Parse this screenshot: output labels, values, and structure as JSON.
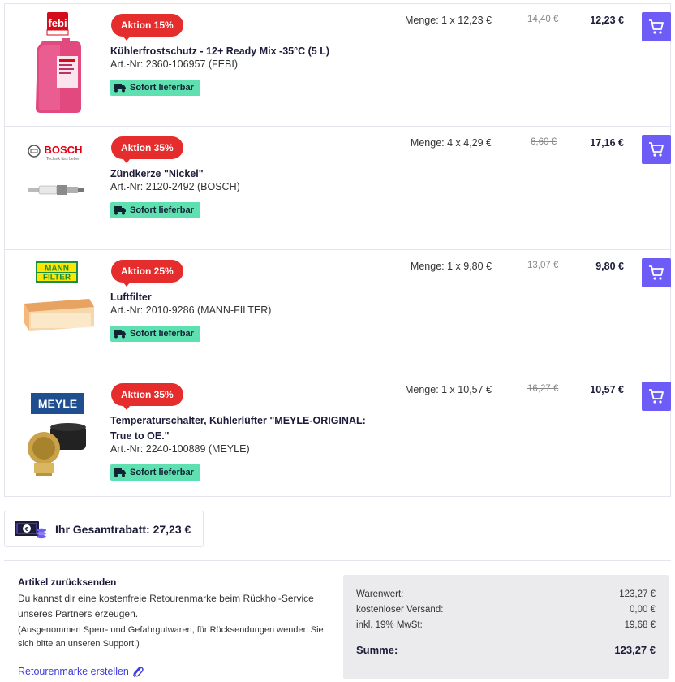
{
  "items": [
    {
      "badge": "Aktion 15%",
      "title": "Kühlerfrostschutz - 12+ Ready Mix -35°C (5 L)",
      "artnr": "Art.-Nr: 2360-106957 (FEBI)",
      "stock": "Sofort lieferbar",
      "qty": "Menge: 1 x 12,23 €",
      "old_price": "14,40 €",
      "price": "12,23 €",
      "brand": "febi bilstein"
    },
    {
      "badge": "Aktion 35%",
      "title": "Zündkerze \"Nickel\"",
      "artnr": "Art.-Nr: 2120-2492 (BOSCH)",
      "stock": "Sofort lieferbar",
      "qty": "Menge: 4 x 4,29 €",
      "old_price": "6,60 €",
      "price": "17,16 €",
      "brand": "BOSCH",
      "brand_tagline": "Technik fürs Leben"
    },
    {
      "badge": "Aktion 25%",
      "title": "Luftfilter",
      "artnr": "Art.-Nr: 2010-9286 (MANN-FILTER)",
      "stock": "Sofort lieferbar",
      "qty": "Menge: 1 x 9,80 €",
      "old_price": "13,07 €",
      "price": "9,80 €",
      "brand_line1": "MANN",
      "brand_line2": "FILTER"
    },
    {
      "badge": "Aktion 35%",
      "title": "Temperaturschalter, Kühlerlüfter \"MEYLE-ORIGINAL: True to OE.\"",
      "artnr": "Art.-Nr: 2240-100889 (MEYLE)",
      "stock": "Sofort lieferbar",
      "qty": "Menge: 1 x 10,57 €",
      "old_price": "16,27 €",
      "price": "10,57 €",
      "brand": "MEYLE"
    }
  ],
  "discount": {
    "label": "Ihr Gesamtrabatt: 27,23 €"
  },
  "return_section": {
    "heading": "Artikel zurücksenden",
    "text": "Du kannst dir eine kostenfreie Retourenmarke beim Rückhol-Service unseres Partners erzeugen.",
    "note": "(Ausgenommen Sperr- und Gefahrgutwaren, für Rücksendungen wenden Sie sich bitte an unseren Support.)",
    "link": "Retourenmarke erstellen"
  },
  "summary": {
    "warenwert_label": "Warenwert:",
    "warenwert": "123,27 €",
    "versand_label": "kostenloser Versand:",
    "versand": "0,00 €",
    "mwst_label": "inkl. 19% MwSt:",
    "mwst": "19,68 €",
    "summe_label": "Summe:",
    "summe": "123,27 €"
  },
  "colors": {
    "accent": "#6e5cf6",
    "badge": "#e52d2d",
    "stock": "#5ee0b0"
  },
  "icons": [
    "cart-icon",
    "truck-icon",
    "money-icon",
    "paperclip-icon"
  ]
}
